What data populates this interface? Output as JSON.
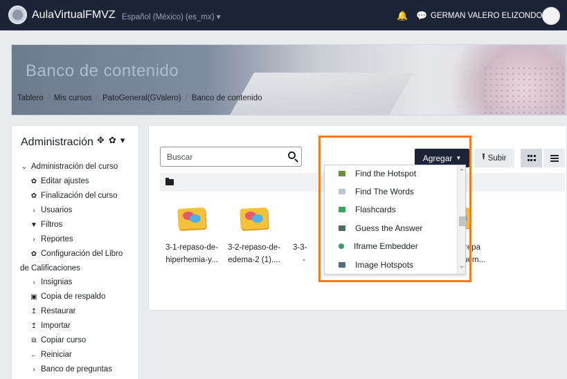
{
  "navbar": {
    "site_name": "AulaVirtualFMVZ",
    "language": "Español (México) (es_mx) ▾",
    "user_name": "GERMAN VALERO ELIZONDO",
    "bell_icon": "bell-icon",
    "chat_icon": "chat-bubble-icon"
  },
  "header": {
    "title": "Banco de contenido",
    "breadcrumb": [
      "Tablero",
      "Mis cursos",
      "PatoGeneral(GValero)",
      "Banco de contenido"
    ],
    "separator": "/"
  },
  "admin": {
    "title": "Administración",
    "controls": [
      "✥",
      "✿",
      "▾"
    ],
    "items": [
      {
        "label": "Administración del curso",
        "icon": "⌄",
        "indent": 0
      },
      {
        "label": "Editar ajustes",
        "icon": "✿",
        "indent": 1
      },
      {
        "label": "Finalización del curso",
        "icon": "✿",
        "indent": 1
      },
      {
        "label": "Usuarios",
        "icon": "›",
        "indent": 1
      },
      {
        "label": "Filtros",
        "icon": "▼",
        "indent": 1
      },
      {
        "label": "Reportes",
        "icon": "›",
        "indent": 1
      },
      {
        "label": "Configuración del Libro",
        "icon": "✿",
        "indent": 1
      },
      {
        "label": "de Calificaciones",
        "icon": "",
        "indent": 0
      },
      {
        "label": "Insignias",
        "icon": "›",
        "indent": 1
      },
      {
        "label": "Copia de respaldo",
        "icon": "▣",
        "indent": 1
      },
      {
        "label": "Restaurar",
        "icon": "↥",
        "indent": 1
      },
      {
        "label": "Importar",
        "icon": "↥",
        "indent": 1
      },
      {
        "label": "Copiar curso",
        "icon": "⧉",
        "indent": 1
      },
      {
        "label": "Reiniciar",
        "icon": "←",
        "indent": 1
      },
      {
        "label": "Banco de preguntas",
        "icon": "›",
        "indent": 1
      }
    ]
  },
  "content": {
    "search_placeholder": "Buscar",
    "add_button": "Agregar",
    "upload_button": "Subir",
    "files": [
      {
        "line1": "3-1-repaso-de-",
        "line2": "hiperhemia-y..."
      },
      {
        "line1": "3-2-repaso-de-",
        "line2": "edema-2 (1)...."
      },
      {
        "line1": "3-3-",
        "line2": "-"
      },
      {
        "line1": "-7-repa",
        "line2": "squem..."
      }
    ]
  },
  "dropdown": {
    "items": [
      {
        "label": "Find the Hotspot",
        "icon_color": "#6a8f3a"
      },
      {
        "label": "Find The Words",
        "icon_color": "#b9c7d6"
      },
      {
        "label": "Flashcards",
        "icon_color": "#3aa55a"
      },
      {
        "label": "Guess the Answer",
        "icon_color": "#4d6d5a"
      },
      {
        "label": "Iframe Embedder",
        "icon_color": "#3a9a6a"
      },
      {
        "label": "Image Hotspots",
        "icon_color": "#5a6a7a"
      }
    ]
  },
  "highlight_color": "#f57a1f"
}
